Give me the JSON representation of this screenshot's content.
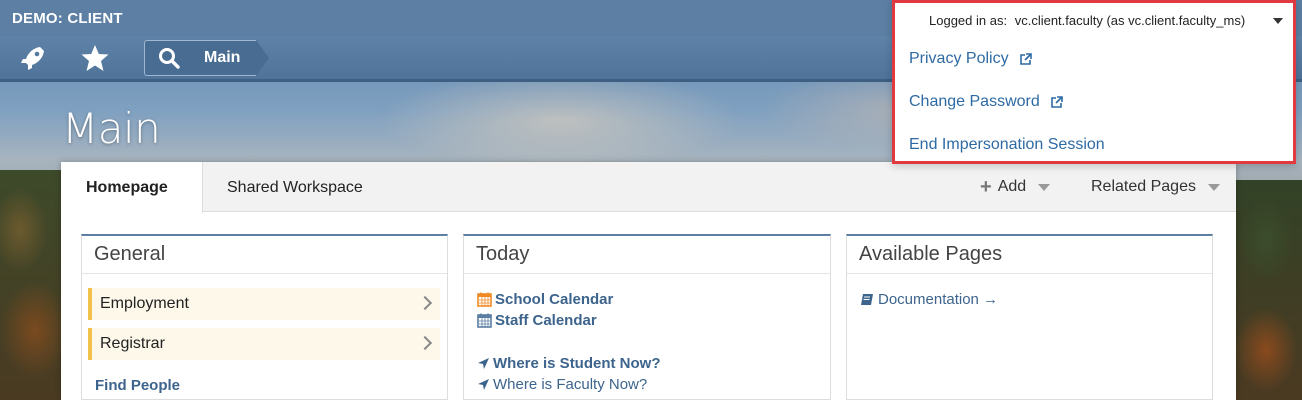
{
  "header": {
    "brand": "DEMO: CLIENT",
    "breadcrumb": "Main"
  },
  "page": {
    "title": "Main"
  },
  "tabs": {
    "homepage": "Homepage",
    "shared_workspace": "Shared Workspace",
    "add": "Add",
    "related_pages": "Related Pages"
  },
  "general": {
    "title": "General",
    "items": [
      {
        "label": "Employment"
      },
      {
        "label": "Registrar"
      }
    ],
    "find_people": "Find People"
  },
  "today": {
    "title": "Today",
    "school_calendar": "School Calendar",
    "staff_calendar": "Staff Calendar",
    "where_student": "Where is Student Now?",
    "where_faculty": "Where is Faculty Now?"
  },
  "available_pages": {
    "title": "Available Pages",
    "documentation": "Documentation →"
  },
  "user_menu": {
    "logged_in_label": "Logged in as:",
    "user": "vc.client.faculty (as vc.client.faculty_ms)",
    "items": [
      {
        "label": "Privacy Policy"
      },
      {
        "label": "Change Password"
      },
      {
        "label": "End Impersonation Session"
      }
    ]
  },
  "colors": {
    "accent": "#5c7fa3",
    "link": "#2e6aa4",
    "highlight_border": "#e0393f",
    "calendar_orange": "#f08a24"
  }
}
